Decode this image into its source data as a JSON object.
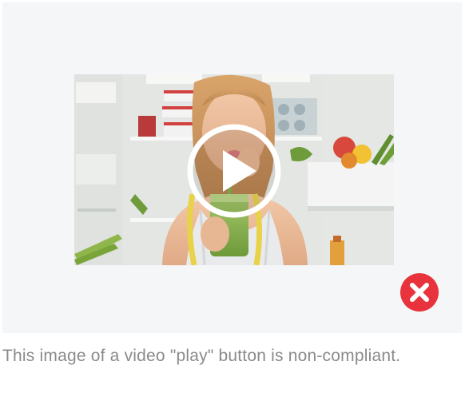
{
  "example": {
    "video_thumbnail": {
      "subject_icon": "woman-drinking-smoothie-in-fridge",
      "overlay_icon": "play-icon"
    },
    "status": {
      "icon": "close-circle-icon",
      "color": "#e8323c",
      "meaning": "non-compliant"
    },
    "caption": "This image of a video \"play\" button is non-compliant."
  }
}
